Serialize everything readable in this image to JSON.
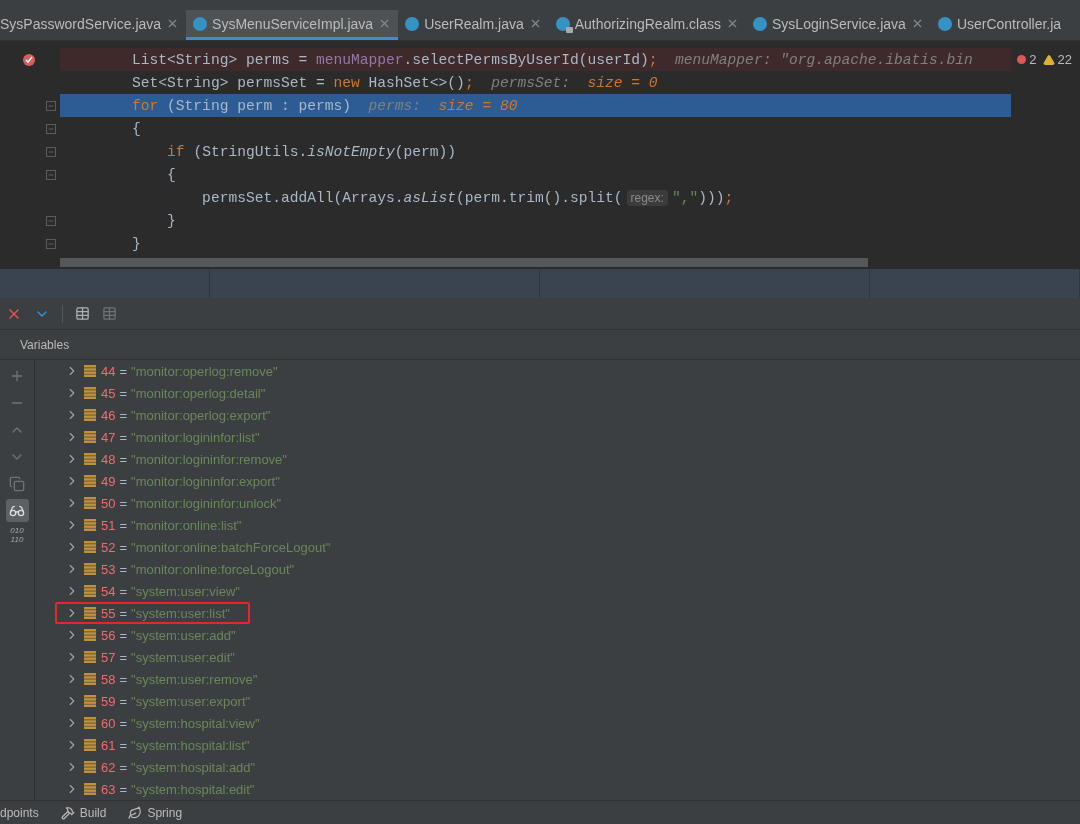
{
  "tabs": [
    {
      "label": "SysPasswordService.java",
      "kind": "none",
      "selected": false,
      "closable": true
    },
    {
      "label": "SysMenuServiceImpl.java",
      "kind": "class",
      "selected": true,
      "closable": true
    },
    {
      "label": "UserRealm.java",
      "kind": "class",
      "selected": false,
      "closable": true
    },
    {
      "label": "AuthorizingRealm.class",
      "kind": "locked-class",
      "selected": false,
      "closable": true
    },
    {
      "label": "SysLoginService.java",
      "kind": "class",
      "selected": false,
      "closable": true
    },
    {
      "label": "UserController.ja",
      "kind": "class",
      "selected": false,
      "closable": false
    }
  ],
  "inspections": {
    "errors": "2",
    "warnings": "22"
  },
  "code": {
    "lines": [
      {
        "error": true,
        "current": false,
        "breakpoint": true,
        "fold": false,
        "tokens": [
          {
            "kind": "plain",
            "text": "        List<String> perms = "
          },
          {
            "kind": "field",
            "text": "menuMapper"
          },
          {
            "kind": "plain",
            "text": ".selectPermsByUserId(userId)"
          },
          {
            "kind": "keyword",
            "text": ";"
          },
          {
            "kind": "hint",
            "text": "  menuMapper: \"org.apache.ibatis.bin"
          }
        ]
      },
      {
        "error": false,
        "current": false,
        "breakpoint": false,
        "fold": false,
        "tokens": [
          {
            "kind": "plain",
            "text": "        Set<String> permsSet = "
          },
          {
            "kind": "keyword",
            "text": "new "
          },
          {
            "kind": "plain",
            "text": "HashSet<>()"
          },
          {
            "kind": "keyword",
            "text": ";"
          },
          {
            "kind": "hint",
            "text": "  permsSet:  "
          },
          {
            "kind": "hint-value",
            "text": "size = 0"
          }
        ]
      },
      {
        "error": false,
        "current": true,
        "breakpoint": false,
        "fold": true,
        "tokens": [
          {
            "kind": "keyword",
            "text": "        for "
          },
          {
            "kind": "plain",
            "text": "(String perm : perms)"
          },
          {
            "kind": "hint",
            "text": "  perms:  "
          },
          {
            "kind": "hint-value",
            "text": "size = 80"
          }
        ]
      },
      {
        "error": false,
        "current": false,
        "breakpoint": false,
        "fold": true,
        "tokens": [
          {
            "kind": "plain",
            "text": "        {"
          }
        ]
      },
      {
        "error": false,
        "current": false,
        "breakpoint": false,
        "fold": true,
        "tokens": [
          {
            "kind": "keyword",
            "text": "            if "
          },
          {
            "kind": "plain",
            "text": "(StringUtils."
          },
          {
            "kind": "method",
            "text": "isNotEmpty"
          },
          {
            "kind": "plain",
            "text": "(perm))"
          }
        ]
      },
      {
        "error": false,
        "current": false,
        "breakpoint": false,
        "fold": true,
        "tokens": [
          {
            "kind": "plain",
            "text": "            {"
          }
        ]
      },
      {
        "error": false,
        "current": false,
        "breakpoint": false,
        "fold": false,
        "tokens": [
          {
            "kind": "plain",
            "text": "                permsSet.addAll(Arrays."
          },
          {
            "kind": "method",
            "text": "asList"
          },
          {
            "kind": "plain",
            "text": "(perm.trim().split("
          },
          {
            "kind": "inlay",
            "text": "regex:"
          },
          {
            "kind": "string",
            "text": "\",\""
          },
          {
            "kind": "plain",
            "text": ")))"
          },
          {
            "kind": "keyword",
            "text": ";"
          }
        ]
      },
      {
        "error": false,
        "current": false,
        "breakpoint": false,
        "fold": true,
        "tokens": [
          {
            "kind": "plain",
            "text": "            }"
          }
        ]
      },
      {
        "error": false,
        "current": false,
        "breakpoint": false,
        "fold": true,
        "tokens": [
          {
            "kind": "plain",
            "text": "        }"
          }
        ]
      }
    ]
  },
  "panel": {
    "title": "Variables",
    "side_tools": [
      {
        "kind": "plus",
        "selected": false
      },
      {
        "kind": "minus",
        "selected": false
      },
      {
        "kind": "up",
        "selected": false
      },
      {
        "kind": "down",
        "selected": false
      },
      {
        "kind": "copy",
        "selected": false
      },
      {
        "kind": "glasses",
        "selected": true
      }
    ],
    "binary_label": [
      "010",
      "110"
    ],
    "variables": [
      {
        "index": "44",
        "separator": "=",
        "value": "\"monitor:operlog:remove\"",
        "highlighted": false
      },
      {
        "index": "45",
        "separator": "=",
        "value": "\"monitor:operlog:detail\"",
        "highlighted": false
      },
      {
        "index": "46",
        "separator": "=",
        "value": "\"monitor:operlog:export\"",
        "highlighted": false
      },
      {
        "index": "47",
        "separator": "=",
        "value": "\"monitor:logininfor:list\"",
        "highlighted": false
      },
      {
        "index": "48",
        "separator": "=",
        "value": "\"monitor:logininfor:remove\"",
        "highlighted": false
      },
      {
        "index": "49",
        "separator": "=",
        "value": "\"monitor:logininfor:export\"",
        "highlighted": false
      },
      {
        "index": "50",
        "separator": "=",
        "value": "\"monitor:logininfor:unlock\"",
        "highlighted": false
      },
      {
        "index": "51",
        "separator": "=",
        "value": "\"monitor:online:list\"",
        "highlighted": false
      },
      {
        "index": "52",
        "separator": "=",
        "value": "\"monitor:online:batchForceLogout\"",
        "highlighted": false
      },
      {
        "index": "53",
        "separator": "=",
        "value": "\"monitor:online:forceLogout\"",
        "highlighted": false
      },
      {
        "index": "54",
        "separator": "=",
        "value": "\"system:user:view\"",
        "highlighted": false
      },
      {
        "index": "55",
        "separator": "=",
        "value": "\"system:user:list\"",
        "highlighted": true
      },
      {
        "index": "56",
        "separator": "=",
        "value": "\"system:user:add\"",
        "highlighted": false
      },
      {
        "index": "57",
        "separator": "=",
        "value": "\"system:user:edit\"",
        "highlighted": false
      },
      {
        "index": "58",
        "separator": "=",
        "value": "\"system:user:remove\"",
        "highlighted": false
      },
      {
        "index": "59",
        "separator": "=",
        "value": "\"system:user:export\"",
        "highlighted": false
      },
      {
        "index": "60",
        "separator": "=",
        "value": "\"system:hospital:view\"",
        "highlighted": false
      },
      {
        "index": "61",
        "separator": "=",
        "value": "\"system:hospital:list\"",
        "highlighted": false
      },
      {
        "index": "62",
        "separator": "=",
        "value": "\"system:hospital:add\"",
        "highlighted": false
      },
      {
        "index": "63",
        "separator": "=",
        "value": "\"system:hospital:edit\"",
        "highlighted": false
      }
    ]
  },
  "bottom_bar": [
    {
      "label": "dpoints",
      "kind": "none"
    },
    {
      "label": "Build",
      "kind": "hammer"
    },
    {
      "label": "Spring",
      "kind": "leaf"
    }
  ]
}
